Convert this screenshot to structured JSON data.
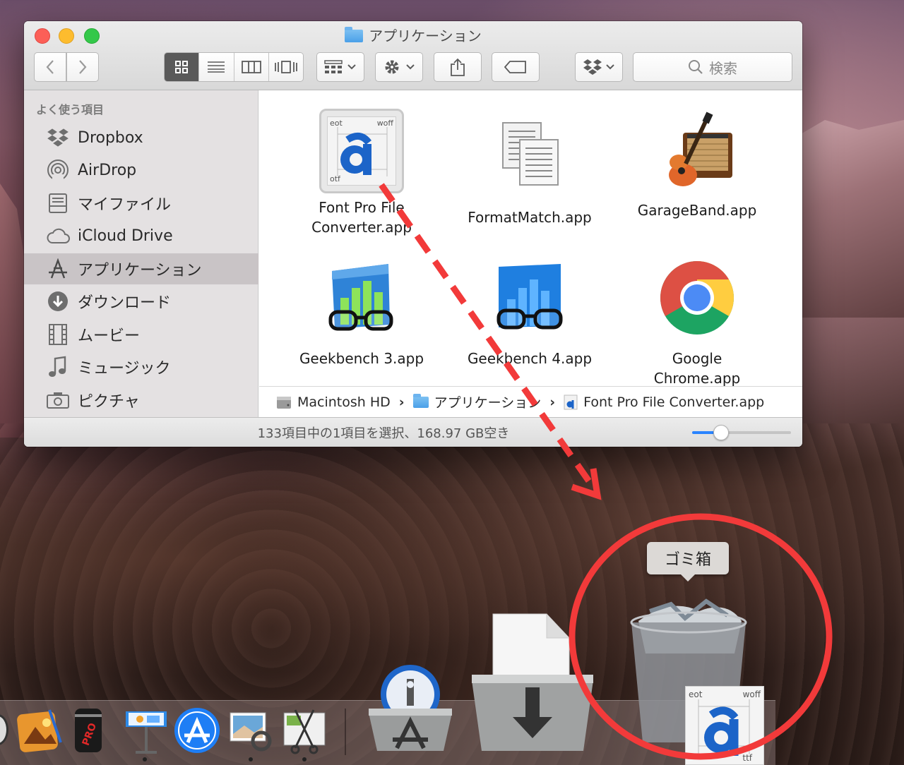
{
  "window": {
    "title": "アプリケーション"
  },
  "toolbar": {
    "search_placeholder": "検索"
  },
  "sidebar": {
    "heading": "よく使う項目",
    "items": [
      {
        "label": "Dropbox",
        "icon": "dropbox-icon"
      },
      {
        "label": "AirDrop",
        "icon": "airdrop-icon"
      },
      {
        "label": "マイファイル",
        "icon": "all-files-icon"
      },
      {
        "label": "iCloud Drive",
        "icon": "cloud-icon"
      },
      {
        "label": "アプリケーション",
        "icon": "applications-icon",
        "active": true
      },
      {
        "label": "ダウンロード",
        "icon": "download-icon"
      },
      {
        "label": "ムービー",
        "icon": "film-icon"
      },
      {
        "label": "ミュージック",
        "icon": "music-note-icon"
      },
      {
        "label": "ピクチャ",
        "icon": "camera-icon"
      }
    ]
  },
  "files": [
    {
      "name_line1": "Font Pro File",
      "name_line2": "Converter.app",
      "selected": true
    },
    {
      "name_line1": "FormatMatch.app"
    },
    {
      "name_line1": "GarageBand.app"
    },
    {
      "name_line1": "Geekbench 3.app"
    },
    {
      "name_line1": "Geekbench 4.app"
    },
    {
      "name_line1": "Google",
      "name_line2": "Chrome.app"
    }
  ],
  "pathbar": {
    "disk": "Macintosh HD",
    "folder": "アプリケーション",
    "file": "Font Pro File Converter.app"
  },
  "status": {
    "text": "133項目中の1項目を選択、168.97 GB空き",
    "icon_size_level": 0.25
  },
  "icon_text": {
    "eot": "eot",
    "woff": "woff",
    "otf": "otf",
    "ttf": "ttf"
  },
  "dock": {
    "tooltip": "ゴミ箱"
  },
  "colors": {
    "selection": "#1b6ae0",
    "annotation": "#f23a3a"
  }
}
